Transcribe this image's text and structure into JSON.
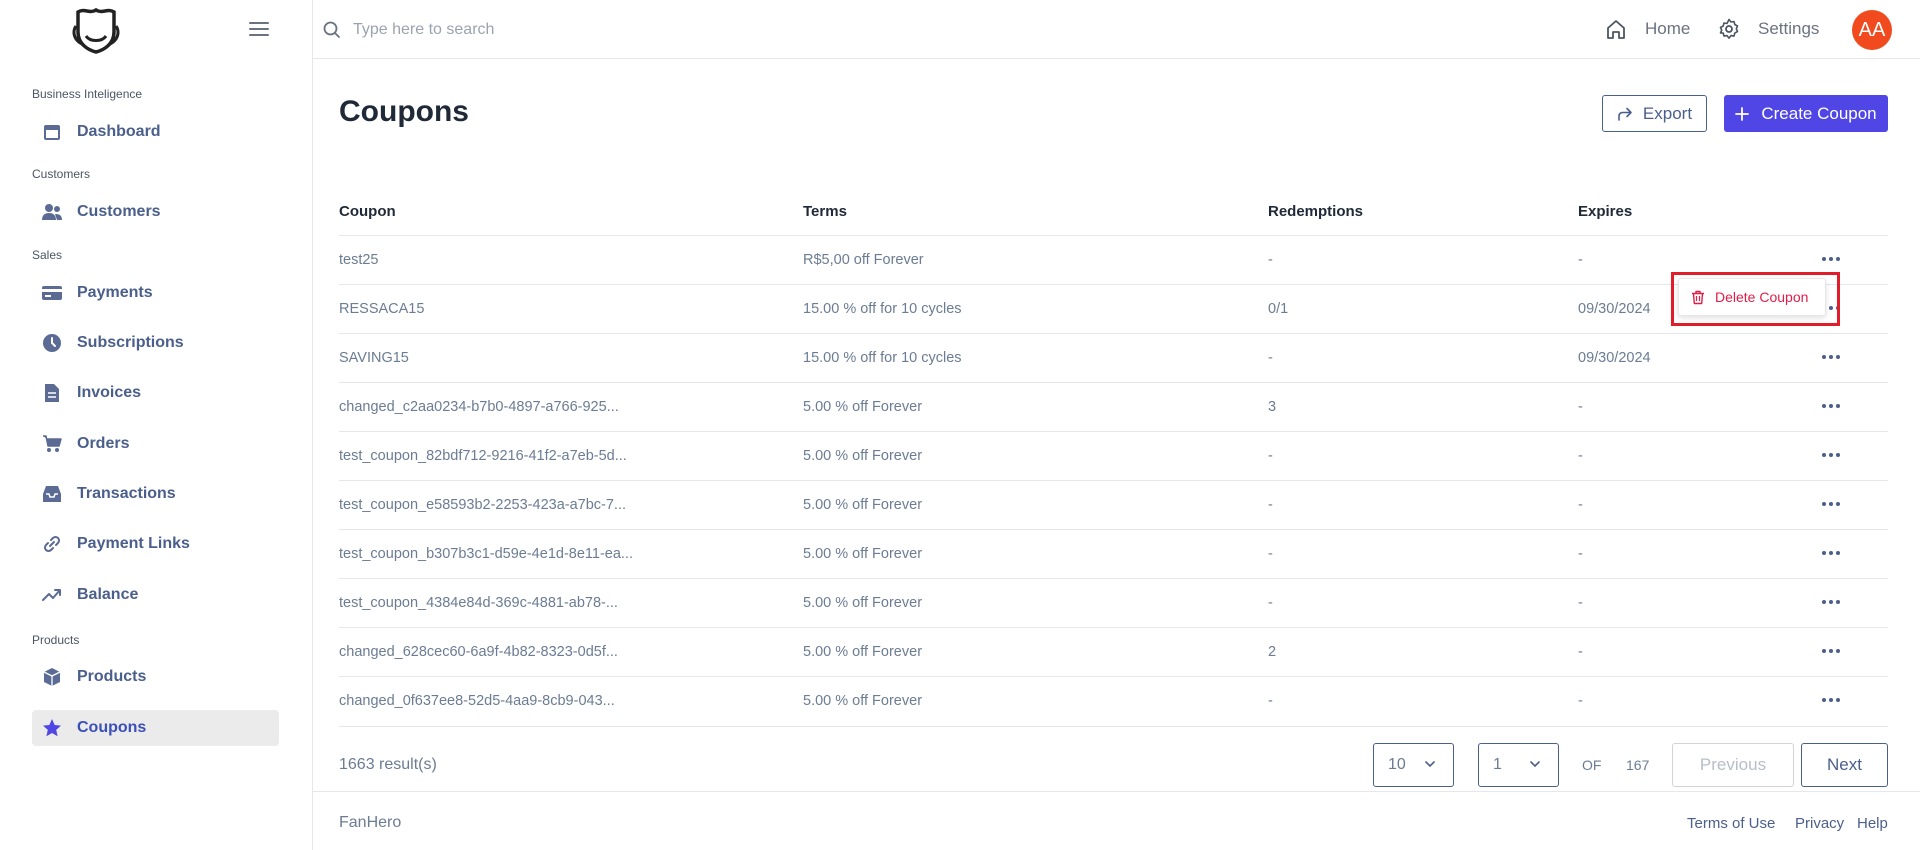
{
  "sidebar": {
    "sections": [
      {
        "label": "Business Inteligence"
      },
      {
        "label": "Customers"
      },
      {
        "label": "Sales"
      },
      {
        "label": "Products"
      }
    ],
    "items": [
      {
        "label": "Dashboard",
        "icon": "calendar-icon"
      },
      {
        "label": "Customers",
        "icon": "users-icon"
      },
      {
        "label": "Payments",
        "icon": "credit-card-icon"
      },
      {
        "label": "Subscriptions",
        "icon": "clock-icon"
      },
      {
        "label": "Invoices",
        "icon": "document-icon"
      },
      {
        "label": "Orders",
        "icon": "cart-icon"
      },
      {
        "label": "Transactions",
        "icon": "inbox-icon"
      },
      {
        "label": "Payment Links",
        "icon": "link-icon"
      },
      {
        "label": "Balance",
        "icon": "trending-up-icon"
      },
      {
        "label": "Products",
        "icon": "cube-icon"
      },
      {
        "label": "Coupons",
        "icon": "star-icon",
        "active": true
      }
    ]
  },
  "header": {
    "search_placeholder": "Type here to search",
    "home_label": "Home",
    "settings_label": "Settings",
    "avatar_initials": "AA",
    "avatar_color": "#f04a1e"
  },
  "main": {
    "title": "Coupons",
    "export_label": "Export",
    "create_label": "Create Coupon",
    "accent_color": "#4f46e5"
  },
  "table": {
    "columns": [
      "Coupon",
      "Terms",
      "Redemptions",
      "Expires"
    ],
    "rows": [
      {
        "coupon": "test25",
        "terms": "R$5,00 off Forever",
        "redemptions": "-",
        "expires": "-"
      },
      {
        "coupon": "RESSACA15",
        "terms": "15.00 % off for 10 cycles",
        "redemptions": "0/1",
        "expires": "09/30/2024"
      },
      {
        "coupon": "SAVING15",
        "terms": "15.00 % off for 10 cycles",
        "redemptions": "-",
        "expires": "09/30/2024"
      },
      {
        "coupon": "changed_c2aa0234-b7b0-4897-a766-925...",
        "terms": "5.00 % off Forever",
        "redemptions": "3",
        "expires": "-"
      },
      {
        "coupon": "test_coupon_82bdf712-9216-41f2-a7eb-5d...",
        "terms": "5.00 % off Forever",
        "redemptions": "-",
        "expires": "-"
      },
      {
        "coupon": "test_coupon_e58593b2-2253-423a-a7bc-7...",
        "terms": "5.00 % off Forever",
        "redemptions": "-",
        "expires": "-"
      },
      {
        "coupon": "test_coupon_b307b3c1-d59e-4e1d-8e11-ea...",
        "terms": "5.00 % off Forever",
        "redemptions": "-",
        "expires": "-"
      },
      {
        "coupon": "test_coupon_4384e84d-369c-4881-ab78-...",
        "terms": "5.00 % off Forever",
        "redemptions": "-",
        "expires": "-"
      },
      {
        "coupon": "changed_628cec60-6a9f-4b82-8323-0d5f...",
        "terms": "5.00 % off Forever",
        "redemptions": "2",
        "expires": "-"
      },
      {
        "coupon": "changed_0f637ee8-52d5-4aa9-8cb9-043...",
        "terms": "5.00 % off Forever",
        "redemptions": "-",
        "expires": "-"
      }
    ]
  },
  "dropdown": {
    "delete_label": "Delete Coupon",
    "color": "#e11d48"
  },
  "pagination": {
    "result_count": "1663 result(s)",
    "page_size": "10",
    "current_page": "1",
    "of_label": "OF",
    "total_pages": "167",
    "previous_label": "Previous",
    "next_label": "Next"
  },
  "footer": {
    "brand": "FanHero",
    "links": [
      "Terms of Use",
      "Privacy",
      "Help"
    ]
  }
}
